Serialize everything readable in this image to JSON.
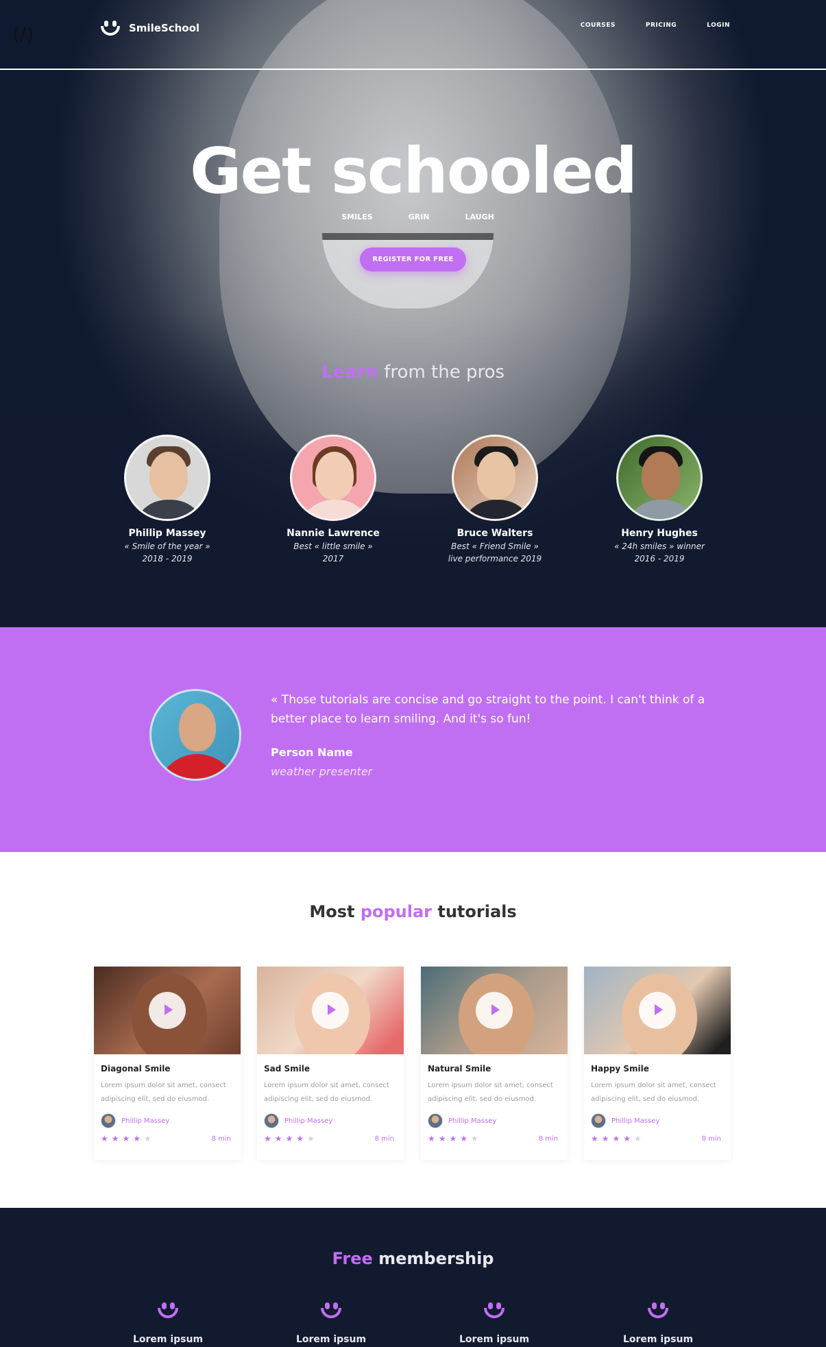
{
  "corner_label": "(/)",
  "header": {
    "brand": "SmileSchool",
    "nav": [
      "COURSES",
      "PRICING",
      "LOGIN"
    ]
  },
  "hero": {
    "title": "Get schooled",
    "subtitles": [
      "SMILES",
      "GRIN",
      "LAUGH"
    ],
    "cta": "REGISTER FOR FREE"
  },
  "pros_section": {
    "heading_accent": "Learn",
    "heading_rest": " from the pros",
    "pros": [
      {
        "name": "Phillip Massey",
        "line1": "« Smile of the year »",
        "line2": "2018 - 2019"
      },
      {
        "name": "Nannie Lawrence",
        "line1": "Best « little smile »",
        "line2": "2017"
      },
      {
        "name": "Bruce Walters",
        "line1": "Best « Friend Smile »",
        "line2": "live performance 2019"
      },
      {
        "name": "Henry Hughes",
        "line1": "« 24h smiles » winner",
        "line2": "2016 - 2019"
      }
    ]
  },
  "testimonial": {
    "quote": "« Those tutorials are concise and go straight to the point. I can't think of a better place to learn smiling. And it's so fun!",
    "name": "Person Name",
    "role": "weather presenter"
  },
  "popular": {
    "heading_pre": "Most ",
    "heading_accent": "popular",
    "heading_post": " tutorials",
    "cards": [
      {
        "title": "Diagonal Smile",
        "desc": "Lorem ipsum dolor sit amet, consect adipiscing elit, sed do eiusmod.",
        "author": "Phillip Massey",
        "rating": 4,
        "duration": "8 min"
      },
      {
        "title": "Sad Smile",
        "desc": "Lorem ipsum dolor sit amet, consect adipiscing elit, sed do eiusmod.",
        "author": "Phillip Massey",
        "rating": 4,
        "duration": "8 min"
      },
      {
        "title": "Natural Smile",
        "desc": "Lorem ipsum dolor sit amet, consect adipiscing elit, sed do eiusmod.",
        "author": "Phillip Massey",
        "rating": 4,
        "duration": "8 min"
      },
      {
        "title": "Happy Smile",
        "desc": "Lorem ipsum dolor sit amet, consect adipiscing elit, sed do eiusmod.",
        "author": "Phillip Massey",
        "rating": 4,
        "duration": "8 min"
      }
    ]
  },
  "membership": {
    "heading_accent": "Free",
    "heading_rest": " membership",
    "features": [
      "Lorem ipsum",
      "Lorem ipsum",
      "Lorem ipsum",
      "Lorem ipsum"
    ]
  },
  "colors": {
    "accent": "#c06ff2",
    "dark_navy": "#121a30"
  },
  "icons": [
    "smile-logo-icon",
    "play-icon",
    "star-icon",
    "smile-feature-icon"
  ]
}
